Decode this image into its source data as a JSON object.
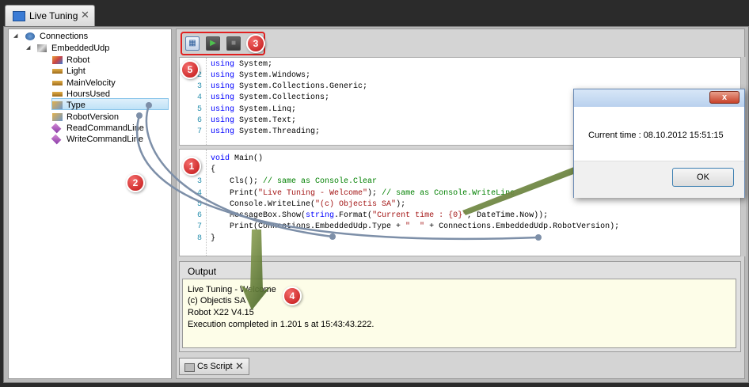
{
  "top_tab": {
    "title": "Live Tuning"
  },
  "tree": {
    "root": "Connections",
    "connection": "EmbeddedUdp",
    "items": [
      "Robot",
      "Light",
      "MainVelocity",
      "HoursUsed",
      "Type",
      "RobotVersion",
      "ReadCommandLine",
      "WriteCommandLine"
    ],
    "selected": "Type"
  },
  "toolbar": {
    "badge": "3",
    "code_badge": "5"
  },
  "using_code": {
    "line_numbers": [
      "2",
      "3",
      "4",
      "5",
      "6",
      "7"
    ],
    "lines": [
      {
        "kw": "using",
        "rest": " System;"
      },
      {
        "kw": "using",
        "rest": " System.Windows;"
      },
      {
        "kw": "using",
        "rest": " System.Collections.Generic;"
      },
      {
        "kw": "using",
        "rest": " System.Collections;"
      },
      {
        "kw": "using",
        "rest": " System.Linq;"
      },
      {
        "kw": "using",
        "rest": " System.Text;"
      },
      {
        "kw": "using",
        "rest": " System.Threading;"
      }
    ]
  },
  "main_code": {
    "line_numbers": [
      "3",
      "4",
      "5",
      "6",
      "7",
      "8"
    ],
    "void_kw": "void",
    "main_sig": " Main()",
    "brace_open": "{",
    "cls": "    Cls(); ",
    "cls_comment": "// same as Console.Clear",
    "print1_a": "    Print(",
    "print1_str": "\"Live Tuning - Welcome\"",
    "print1_b": "); ",
    "print1_comment": "// same as Console.WriteLine",
    "wl_a": "    Console.WriteLine(",
    "wl_str": "\"(c) Objectis SA\"",
    "wl_b": ");",
    "mb_a": "    MessageBox.Show(",
    "mb_kw": "string",
    "mb_b": ".Format(",
    "mb_str": "\"Current time : {0}\"",
    "mb_c": ", DateTime.Now));",
    "p2_a": "    Print(Connections.EmbeddedUdp.Type + ",
    "p2_str": "\"  \"",
    "p2_b": " + Connections.EmbeddedUdp.RobotVersion);",
    "brace_close": "}",
    "badge": "1"
  },
  "tree_badge": "2",
  "output": {
    "header": "Output",
    "lines": [
      "Live Tuning - Welcome",
      "(c) Objectis SA",
      "Robot X22  V4.15",
      "Execution completed in 1.201 s at 15:43:43.222."
    ],
    "badge": "4"
  },
  "bottom_tab": {
    "label": "Cs Script"
  },
  "dialog": {
    "message": "Current time : 08.10.2012 15:51:15",
    "ok_label": "OK",
    "close_label": "x"
  },
  "colors": {
    "keyword": "#0000ff",
    "string": "#a31515",
    "comment": "#008000",
    "badge": "#d21a1a",
    "arrow": "#7d8fa8"
  }
}
